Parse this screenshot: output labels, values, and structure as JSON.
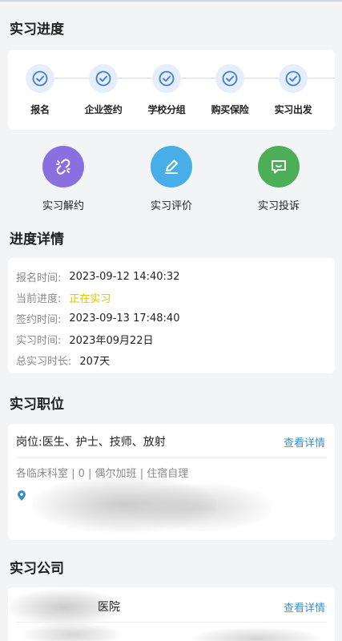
{
  "sections": {
    "progress_title": "实习进度",
    "details_title": "进度详情",
    "position_title": "实习职位",
    "company_title": "实习公司"
  },
  "steps": [
    {
      "label": "报名",
      "icon": "check-circle-icon",
      "done": true
    },
    {
      "label": "企业签约",
      "icon": "check-circle-icon",
      "done": true
    },
    {
      "label": "学校分组",
      "icon": "check-circle-icon",
      "done": true
    },
    {
      "label": "购买保险",
      "icon": "check-circle-icon",
      "done": true
    },
    {
      "label": "实习出发",
      "icon": "check-circle-icon",
      "done": true
    }
  ],
  "actions": [
    {
      "label": "实习解约",
      "icon": "unlink-icon",
      "color": "#8b6fe0"
    },
    {
      "label": "实习评价",
      "icon": "pencil-icon",
      "color": "#48aee8"
    },
    {
      "label": "实习投诉",
      "icon": "message-icon",
      "color": "#4cae57"
    }
  ],
  "details": [
    {
      "key": "报名时间:",
      "value": "2023-09-12 14:40:32"
    },
    {
      "key": "当前进度:",
      "value": "正在实习"
    },
    {
      "key": "签约时间:",
      "value": "2023-09-13 17:48:40"
    },
    {
      "key": "实习时间:",
      "value": "2023年09月22日"
    },
    {
      "key": "总实习时长:",
      "value": "207天"
    }
  ],
  "position": {
    "title": "岗位:医生、护士、技师、放射",
    "view_link": "查看详情",
    "tags": "各临床科室 | 0 | 偶尔加班 | 住宿自理"
  },
  "company": {
    "name": "医院",
    "view_link": "查看详情"
  },
  "colors": {
    "accent": "#3b8fc9",
    "status": "#e6c200",
    "step_circle": "#e6eefc",
    "step_check": "#3b7dd8"
  }
}
